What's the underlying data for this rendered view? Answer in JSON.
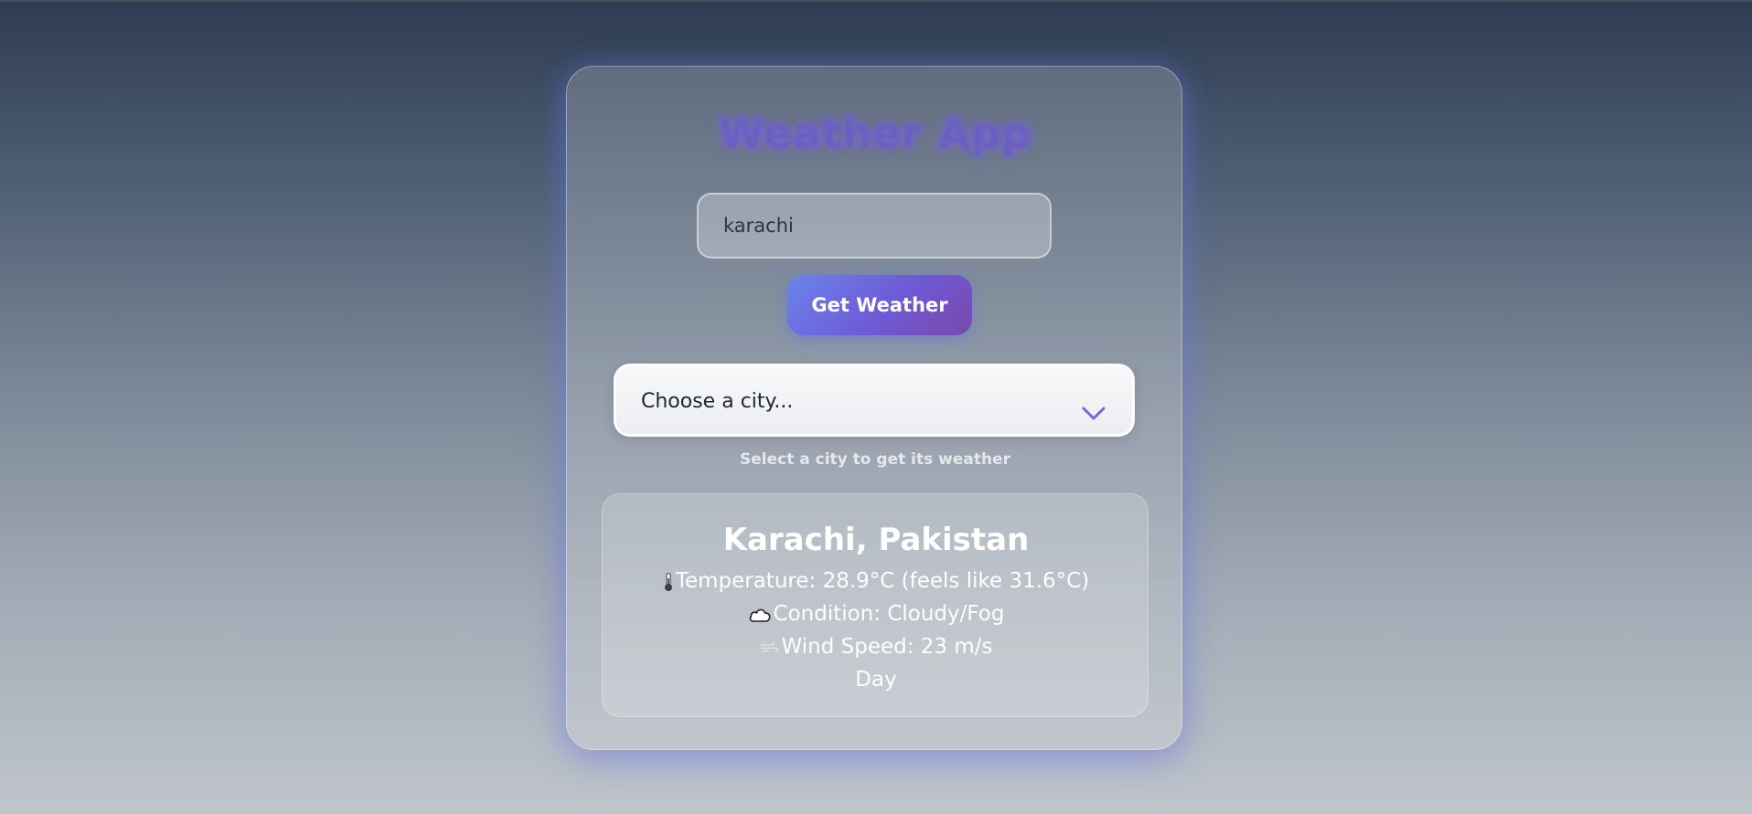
{
  "app": {
    "title": "Weather App"
  },
  "search": {
    "value": "karachi",
    "button_label": "Get Weather"
  },
  "city_select": {
    "selected": "Choose a city...",
    "hint": "Select a city to get its weather"
  },
  "weather": {
    "location": "Karachi, Pakistan",
    "temperature": "Temperature: 28.9°C (feels like 31.6°C)",
    "condition": "Condition: Cloudy/Fog",
    "wind": "Wind Speed: 23 m/s",
    "time_of_day": "Day",
    "icons": {
      "temperature": "thermometer-icon",
      "condition": "cloud-icon",
      "wind": "wind-icon"
    }
  },
  "colors": {
    "title": "#6c5fc2",
    "button_start": "#6a83ec",
    "button_end": "#7848ad",
    "chevron": "#7d63d8"
  }
}
